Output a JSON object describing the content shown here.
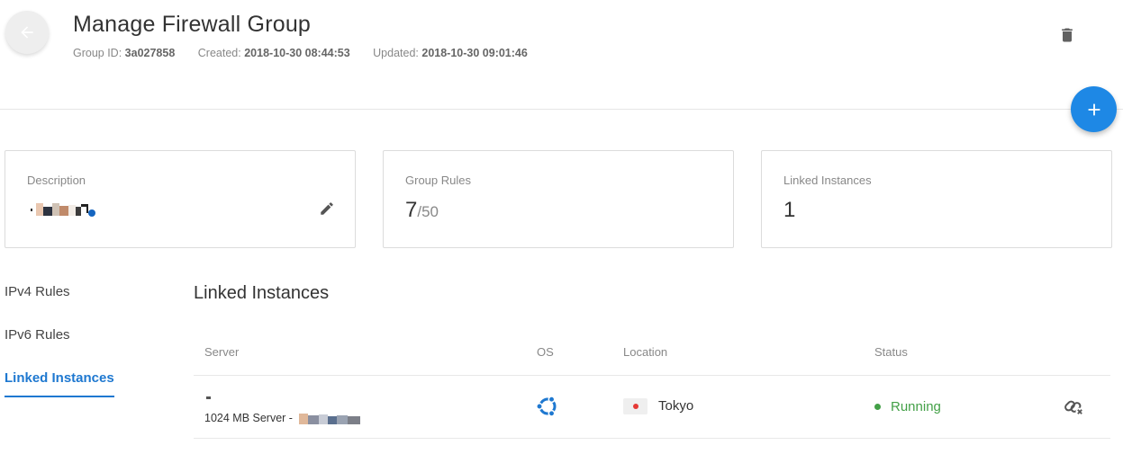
{
  "header": {
    "title": "Manage Firewall Group",
    "group_id_label": "Group ID:",
    "group_id": "3a027858",
    "created_label": "Created:",
    "created": "2018-10-30 08:44:53",
    "updated_label": "Updated:",
    "updated": "2018-10-30 09:01:46"
  },
  "cards": {
    "description_label": "Description",
    "group_rules_label": "Group Rules",
    "group_rules_count": "7",
    "group_rules_max": "/50",
    "linked_instances_label": "Linked Instances",
    "linked_instances_count": "1"
  },
  "tabs": [
    {
      "label": "IPv4 Rules",
      "active": false
    },
    {
      "label": "IPv6 Rules",
      "active": false
    },
    {
      "label": "Linked Instances",
      "active": true
    }
  ],
  "section": {
    "title": "Linked Instances"
  },
  "table": {
    "columns": [
      "Server",
      "OS",
      "Location",
      "Status"
    ],
    "rows": [
      {
        "server_line2": "1024 MB Server -",
        "os": "ubuntu-icon",
        "location": "Tokyo",
        "status": "Running"
      }
    ]
  },
  "icons": {
    "back": "arrow-left-icon",
    "trash": "trash-icon",
    "add": "plus-icon",
    "edit": "pencil-icon",
    "unlink": "unlink-icon"
  },
  "colors": {
    "accent": "#1e88e5",
    "active_tab": "#1e78d0",
    "status_running": "#43a047",
    "flag_japan": "#e53935"
  }
}
